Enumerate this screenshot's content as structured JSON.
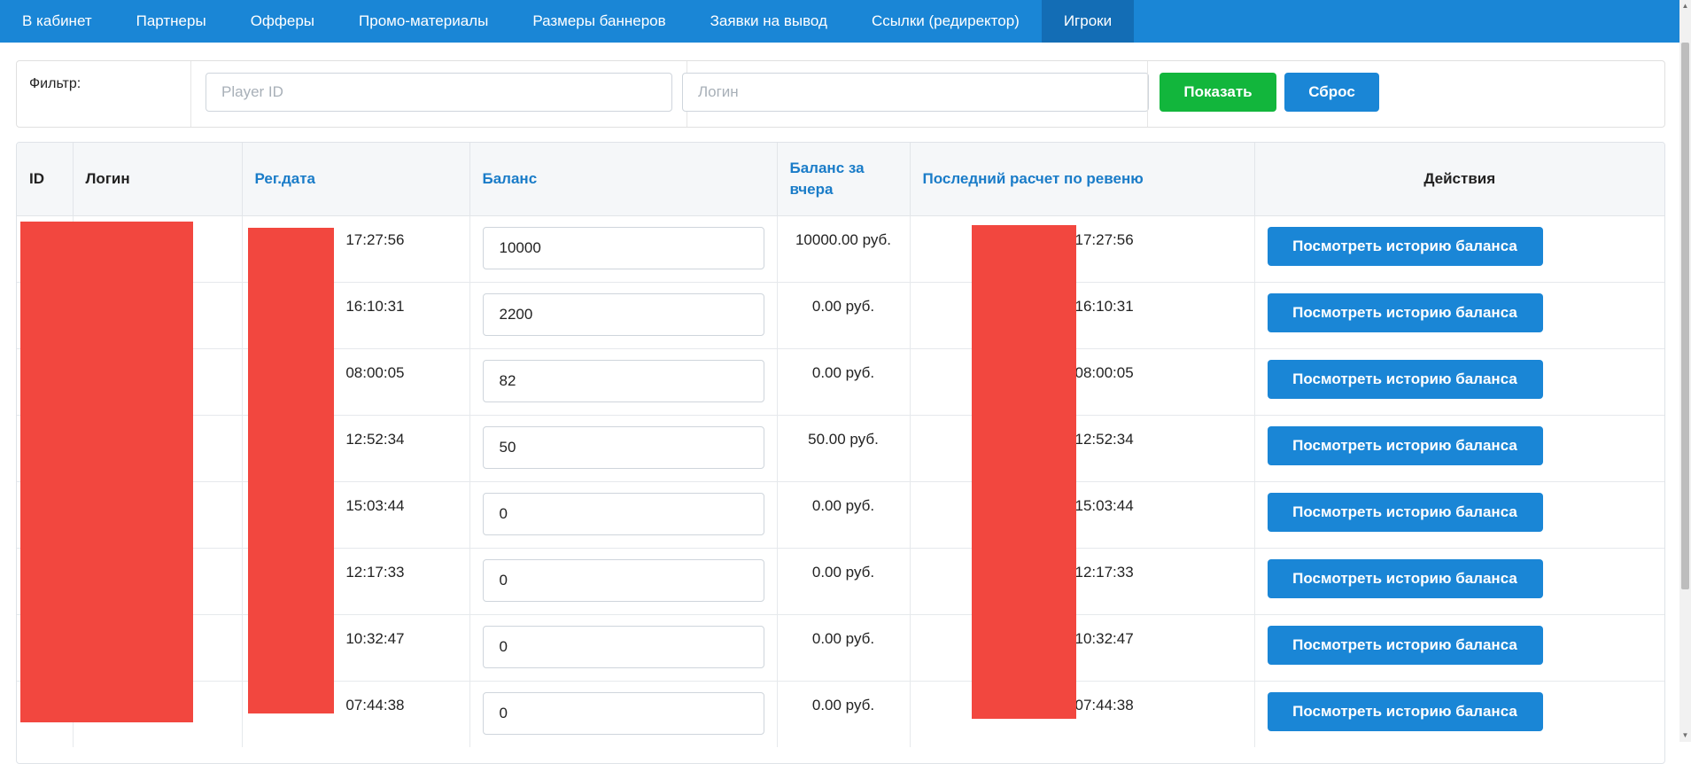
{
  "nav": {
    "items": [
      {
        "label": "В кабинет"
      },
      {
        "label": "Партнеры"
      },
      {
        "label": "Офферы"
      },
      {
        "label": "Промо-материалы"
      },
      {
        "label": "Размеры баннеров"
      },
      {
        "label": "Заявки на вывод"
      },
      {
        "label": "Ссылки (редиректор)"
      },
      {
        "label": "Игроки"
      }
    ],
    "active": "Игроки"
  },
  "filter": {
    "label": "Фильтр:",
    "player_id_placeholder": "Player ID",
    "login_placeholder": "Логин",
    "show_button": "Показать",
    "reset_button": "Сброс"
  },
  "table": {
    "headers": {
      "id": "ID",
      "login": "Логин",
      "reg_date": "Рег.дата",
      "balance": "Баланс",
      "balance_yesterday": "Баланс за вчера",
      "last_revenue_calc": "Последний расчет по ревеню",
      "actions": "Действия"
    },
    "action_label": "Посмотреть историю баланса",
    "rows": [
      {
        "reg_time": "17:27:56",
        "balance": "10000",
        "balance_yesterday": "10000.00 руб.",
        "last_calc_time": "17:27:56"
      },
      {
        "reg_time": "16:10:31",
        "balance": "2200",
        "balance_yesterday": "0.00 руб.",
        "last_calc_time": "16:10:31"
      },
      {
        "reg_time": "08:00:05",
        "balance": "82",
        "balance_yesterday": "0.00 руб.",
        "last_calc_time": "08:00:05"
      },
      {
        "reg_time": "12:52:34",
        "balance": "50",
        "balance_yesterday": "50.00 руб.",
        "last_calc_time": "12:52:34"
      },
      {
        "reg_time": "15:03:44",
        "balance": "0",
        "balance_yesterday": "0.00 руб.",
        "last_calc_time": "15:03:44"
      },
      {
        "reg_time": "12:17:33",
        "balance": "0",
        "balance_yesterday": "0.00 руб.",
        "last_calc_time": "12:17:33"
      },
      {
        "reg_time": "10:32:47",
        "balance": "0",
        "balance_yesterday": "0.00 руб.",
        "last_calc_time": "10:32:47"
      },
      {
        "reg_time": "07:44:38",
        "balance": "0",
        "balance_yesterday": "0.00 руб.",
        "last_calc_time": "07:44:38"
      }
    ]
  },
  "colors": {
    "nav_bg": "#1a86d6",
    "nav_active_bg": "#136db5",
    "show_button": "#12b63c",
    "primary_button": "#1a86d6",
    "link_header": "#1a7cc8",
    "redaction": "#f2473f"
  }
}
